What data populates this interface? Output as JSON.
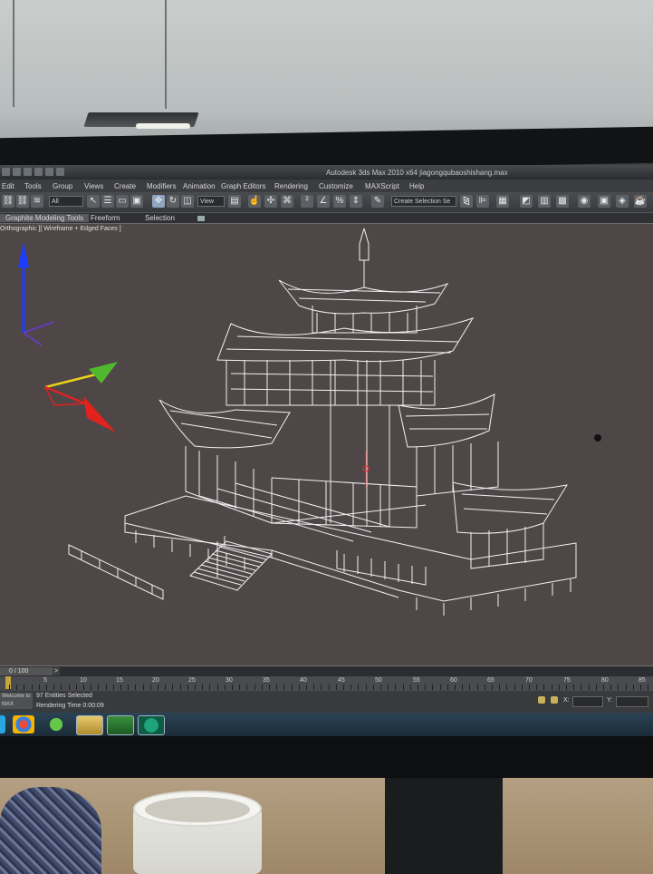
{
  "window": {
    "title": "Autodesk 3ds Max 2010 x64    jiagongqubaoshishang.max"
  },
  "menu": {
    "items": [
      "Edit",
      "Tools",
      "Group",
      "Views",
      "Create",
      "Modifiers",
      "Animation",
      "Graph Editors",
      "Rendering",
      "Customize",
      "MAXScript",
      "Help"
    ]
  },
  "toolbar": {
    "filter_value": "All",
    "view_value": "View",
    "selection_set_placeholder": "Create Selection Se"
  },
  "ribbon": {
    "tabs": [
      "Graphite Modeling Tools",
      "Freeform",
      "Selection"
    ]
  },
  "viewport": {
    "label": "Orthographic ][ Wireframe + Edged Faces ]"
  },
  "timeline": {
    "slider_label": "0 / 100",
    "arrow_label": ">",
    "ruler_ticks": [
      "0",
      "5",
      "10",
      "15",
      "20",
      "25",
      "30",
      "35",
      "40",
      "45",
      "50",
      "55",
      "60",
      "65",
      "70",
      "75",
      "80",
      "85"
    ]
  },
  "status": {
    "listener_label": "Welcome to MAX",
    "selection_text": "97 Entities Selected",
    "render_time_text": "Rendering Time  0:00:09",
    "x_label": "X:",
    "y_label": "Y:"
  },
  "colors": {
    "viewport_bg": "#4f4647",
    "wireframe": "#f2f2f2",
    "gizmo_z": "#1c3cff",
    "gizmo_y": "#4fb82f",
    "gizmo_x": "#e3231b"
  }
}
